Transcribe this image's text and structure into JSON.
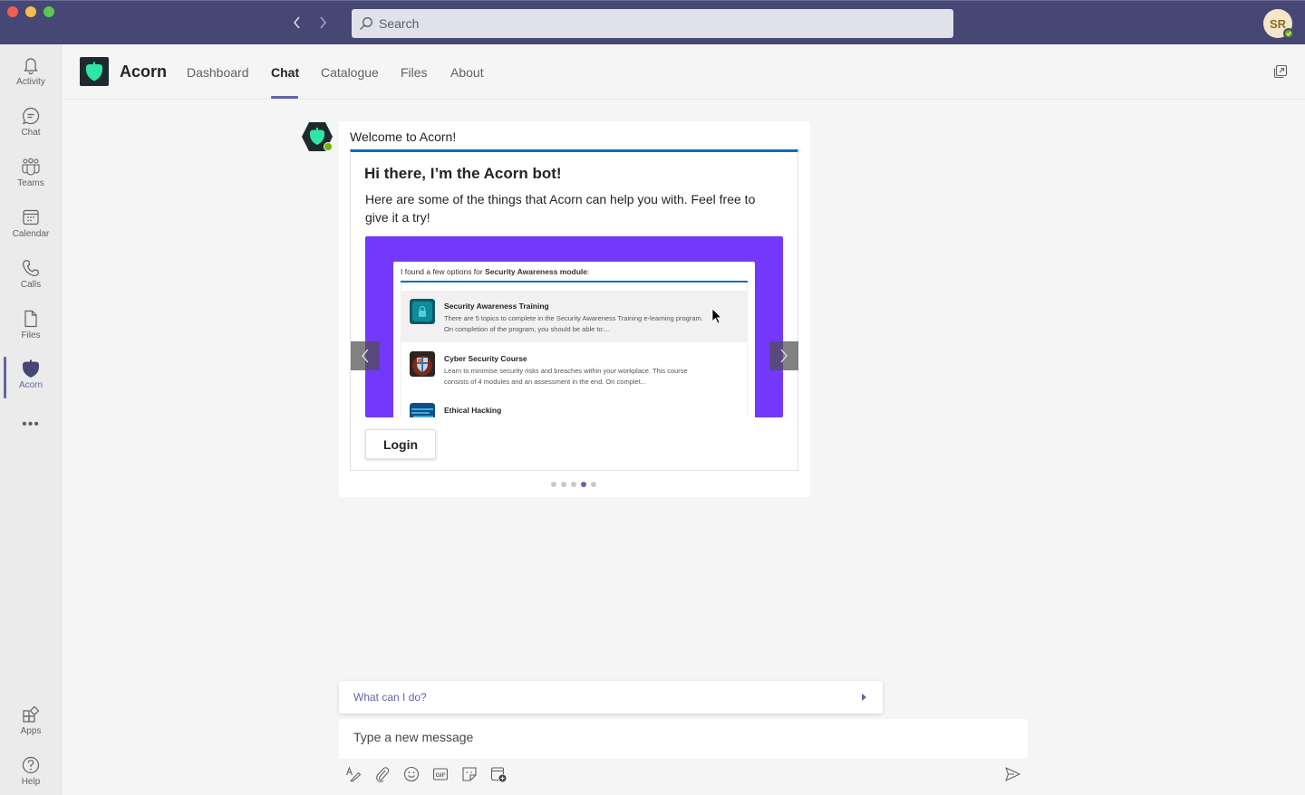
{
  "window": {
    "controls": [
      "close",
      "minimize",
      "maximize"
    ]
  },
  "titlebar": {
    "back_icon": "chevron-left",
    "forward_icon": "chevron-right",
    "search_placeholder": "Search",
    "user_initials": "SR",
    "user_status": "available"
  },
  "rail": {
    "items": [
      {
        "label": "Activity",
        "icon": "bell-icon"
      },
      {
        "label": "Chat",
        "icon": "chat-icon"
      },
      {
        "label": "Teams",
        "icon": "teams-icon"
      },
      {
        "label": "Calendar",
        "icon": "calendar-icon"
      },
      {
        "label": "Calls",
        "icon": "phone-icon"
      },
      {
        "label": "Files",
        "icon": "file-icon"
      },
      {
        "label": "Acorn",
        "icon": "acorn-icon",
        "active": true
      }
    ],
    "more": "•••",
    "bottom": [
      {
        "label": "Apps",
        "icon": "apps-icon"
      },
      {
        "label": "Help",
        "icon": "help-icon"
      }
    ]
  },
  "app": {
    "name": "Acorn",
    "tabs": [
      {
        "label": "Dashboard"
      },
      {
        "label": "Chat",
        "active": true
      },
      {
        "label": "Catalogue"
      },
      {
        "label": "Files"
      },
      {
        "label": "About"
      }
    ],
    "brand_color": "#2ee6a6",
    "accent_color": "#6264a7"
  },
  "message": {
    "title": "Welcome to Acorn!",
    "card": {
      "heading": "Hi there, I’m the Acorn bot!",
      "body": "Here are some of the things that Acorn can help you with. Feel free to give it a try!",
      "hero": {
        "background": "#7438fb",
        "intro_prefix": "I found a few options for ",
        "intro_bold": "Security Awareness module",
        "intro_suffix": ":",
        "results": [
          {
            "title": "Security Awareness Training",
            "description": "There are 5 topics to complete in the Security Awareness Training e-learning program. On completion of the program, you should be able to:...",
            "thumb_icon": "lock-icon"
          },
          {
            "title": "Cyber Security Course",
            "description": "Learn to minimise security risks and breaches within your workplace. This course consists of 4 modules and an assessment in the end. On complet...",
            "thumb_icon": "shield-icon"
          },
          {
            "title": "Ethical Hacking",
            "description": "",
            "thumb_icon": "code-icon"
          }
        ]
      },
      "button_label": "Login"
    },
    "carousel": {
      "total": 5,
      "current": 4
    }
  },
  "compose": {
    "suggested_action": "What can I do?",
    "placeholder": "Type a new message",
    "tools": [
      "format-icon",
      "attach-icon",
      "emoji-icon",
      "gif-icon",
      "sticker-icon",
      "schedule-meeting-icon"
    ],
    "send_icon": "send-icon"
  }
}
